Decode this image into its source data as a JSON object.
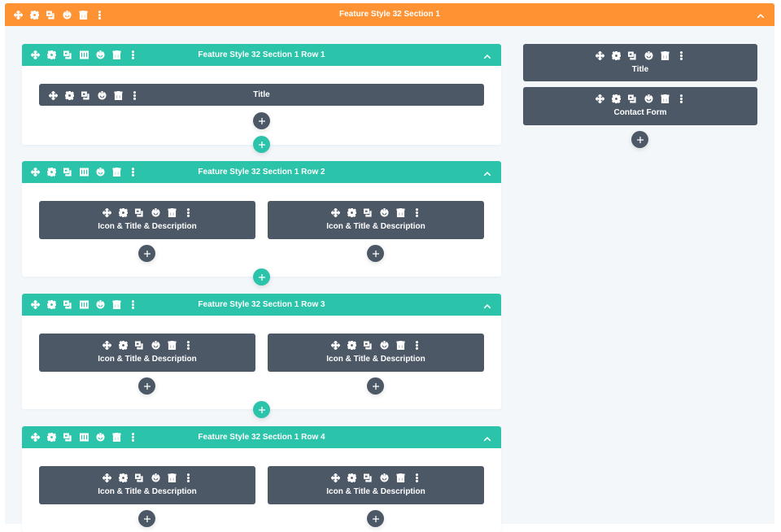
{
  "colors": {
    "section": "#ff9232",
    "row": "#2bc3aa",
    "module": "#4c5866",
    "canvas": "#f4f7fa"
  },
  "section": {
    "title": "Feature Style 32 Section 1",
    "toolbar_icons": [
      "move-icon",
      "settings-icon",
      "duplicate-icon",
      "save-icon",
      "delete-icon",
      "more-icon"
    ],
    "collapse_icon": "chevron-up-icon"
  },
  "rows": [
    {
      "title": "Feature Style 32 Section 1 Row 1",
      "toolbar_icons": [
        "move-icon",
        "settings-icon",
        "duplicate-icon",
        "columns-icon",
        "save-icon",
        "delete-icon",
        "more-icon"
      ],
      "modules": [
        {
          "label": "Title"
        }
      ]
    },
    {
      "title": "Feature Style 32 Section 1 Row 2",
      "modules": [
        {
          "label": "Icon & Title & Description"
        },
        {
          "label": "Icon & Title & Description"
        }
      ]
    },
    {
      "title": "Feature Style 32 Section 1 Row 3",
      "modules": [
        {
          "label": "Icon & Title & Description"
        },
        {
          "label": "Icon & Title & Description"
        }
      ]
    },
    {
      "title": "Feature Style 32 Section 1 Row 4",
      "modules": [
        {
          "label": "Icon & Title & Description"
        },
        {
          "label": "Icon & Title & Description"
        }
      ]
    }
  ],
  "sidebar_column": {
    "modules": [
      {
        "label": "Title"
      },
      {
        "label": "Contact Form"
      }
    ]
  },
  "module_toolbar_icons": [
    "move-icon",
    "settings-icon",
    "duplicate-icon",
    "save-icon",
    "delete-icon",
    "more-icon"
  ],
  "add_module_label": "+",
  "add_row_label": "+"
}
